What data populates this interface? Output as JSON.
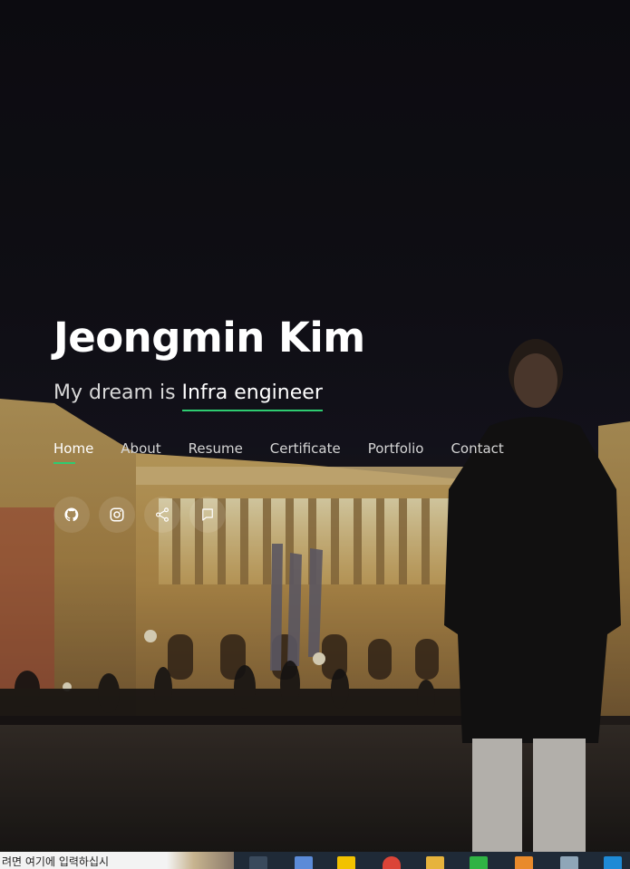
{
  "hero": {
    "name": "Jeongmin Kim",
    "tagline_prefix": "My dream is",
    "tagline_typed": "Infra engineer"
  },
  "nav": {
    "items": [
      {
        "label": "Home",
        "active": true
      },
      {
        "label": "About"
      },
      {
        "label": "Resume"
      },
      {
        "label": "Certificate"
      },
      {
        "label": "Portfolio"
      },
      {
        "label": "Contact"
      }
    ]
  },
  "social": {
    "icons": [
      "github-icon",
      "instagram-icon",
      "share-icon",
      "blog-icon"
    ]
  },
  "taskbar": {
    "search_placeholder": "려면 여기에 입력하십시"
  },
  "colors": {
    "accent": "#2ecc71",
    "text": "#ffffff",
    "taskbar": "#1f2a37"
  }
}
